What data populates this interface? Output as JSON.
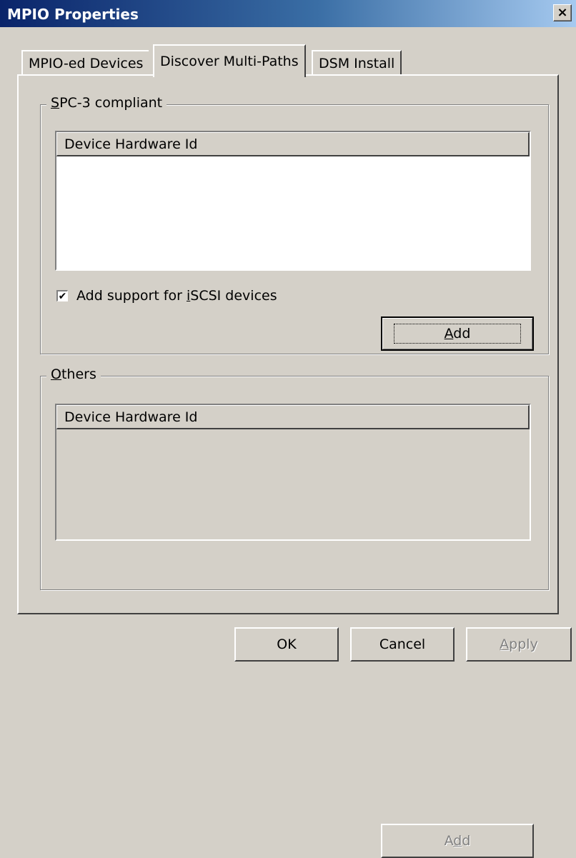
{
  "window": {
    "title": "MPIO Properties",
    "close_glyph": "×"
  },
  "tabs": [
    {
      "label": "MPIO-ed Devices",
      "selected": false
    },
    {
      "label": "Discover Multi-Paths",
      "selected": true
    },
    {
      "label": "DSM Install",
      "selected": false
    }
  ],
  "spc3": {
    "group_label_mnemonic": "S",
    "group_label_rest": "PC-3 compliant",
    "column_header": "Device Hardware Id",
    "checkbox_pre": "Add support for ",
    "checkbox_mnemonic": "i",
    "checkbox_post": "SCSI devices",
    "checkbox_checked": true,
    "add_pre": "",
    "add_mnemonic": "A",
    "add_post": "dd"
  },
  "others": {
    "group_label_mnemonic": "O",
    "group_label_rest": "thers",
    "column_header": "Device Hardware Id",
    "add_pre": "A",
    "add_mnemonic": "d",
    "add_post": "d"
  },
  "footer": {
    "ok": "OK",
    "cancel": "Cancel",
    "apply_mnemonic": "A",
    "apply_rest": "pply"
  }
}
